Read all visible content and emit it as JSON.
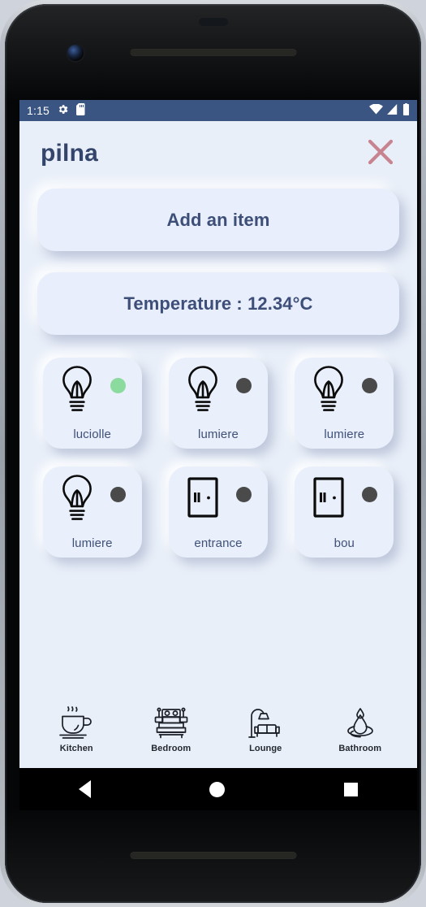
{
  "status_bar": {
    "time": "1:15",
    "left_icons": [
      "gear-icon",
      "sd-card-icon"
    ],
    "right_icons": [
      "wifi-icon",
      "signal-icon",
      "battery-icon"
    ],
    "background": "#3b5583"
  },
  "header": {
    "title": "pilna",
    "close_icon": "close-icon",
    "close_color": "#c78490",
    "title_color": "#34456b"
  },
  "actions": {
    "add_item_label": "Add an item",
    "temperature_label": "Temperature : 12.34°C"
  },
  "devices": [
    {
      "name": "luciolle",
      "icon": "lightbulb-icon",
      "state": "on",
      "dot_color": "#8bdb9e"
    },
    {
      "name": "lumiere",
      "icon": "lightbulb-icon",
      "state": "off",
      "dot_color": "#4a4a4a"
    },
    {
      "name": "lumiere",
      "icon": "lightbulb-icon",
      "state": "off",
      "dot_color": "#4a4a4a"
    },
    {
      "name": "lumiere",
      "icon": "lightbulb-icon",
      "state": "off",
      "dot_color": "#4a4a4a"
    },
    {
      "name": "entrance",
      "icon": "door-icon",
      "state": "off",
      "dot_color": "#4a4a4a"
    },
    {
      "name": "bou",
      "icon": "door-icon",
      "state": "off",
      "dot_color": "#4a4a4a"
    }
  ],
  "rooms": [
    {
      "label": "Kitchen",
      "icon": "coffee-cup-icon"
    },
    {
      "label": "Bedroom",
      "icon": "bed-icon"
    },
    {
      "label": "Lounge",
      "icon": "sofa-lamp-icon"
    },
    {
      "label": "Bathroom",
      "icon": "water-drop-icon"
    }
  ],
  "android_nav": {
    "back": "back-triangle-icon",
    "home": "home-circle-icon",
    "recents": "recents-square-icon"
  },
  "theme": {
    "page_background": "#e9eff9",
    "card_background": "#e8eefb",
    "text_primary": "#3d4f78"
  }
}
